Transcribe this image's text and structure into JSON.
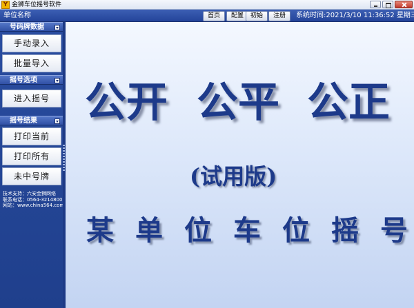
{
  "window": {
    "icon_glyph": "Y",
    "title": "金狮车位摇号软件"
  },
  "header": {
    "unit_name": "单位名称",
    "nav": [
      "首页",
      "配置",
      "初始",
      "注册"
    ],
    "system_time_label": "系统时间:",
    "system_time": "2021/3/10 11:36:52",
    "weekday": "星期三"
  },
  "sidebar": {
    "sections": [
      {
        "label": "号码牌数据",
        "buttons": [
          "手动录入",
          "批量导入"
        ]
      },
      {
        "label": "摇号选项",
        "buttons": [
          "进入摇号"
        ]
      },
      {
        "label": "摇号结果",
        "buttons": [
          "打印当前",
          "打印所有",
          "未中号牌"
        ]
      }
    ],
    "support": {
      "line1": "技术支持：六安金狮网络",
      "line2": "联系电话：0564-3214800",
      "line3": "网站：www.china564.com"
    }
  },
  "main": {
    "slogan": [
      "公开",
      "公平",
      "公正"
    ],
    "trial_label": "(试用版)",
    "lottery_title": "某单位车位摇号"
  },
  "colors": {
    "accent": "#1d3a8a",
    "sidebar_bg": "#2a4da0",
    "main_bg": "#dde8fa"
  }
}
